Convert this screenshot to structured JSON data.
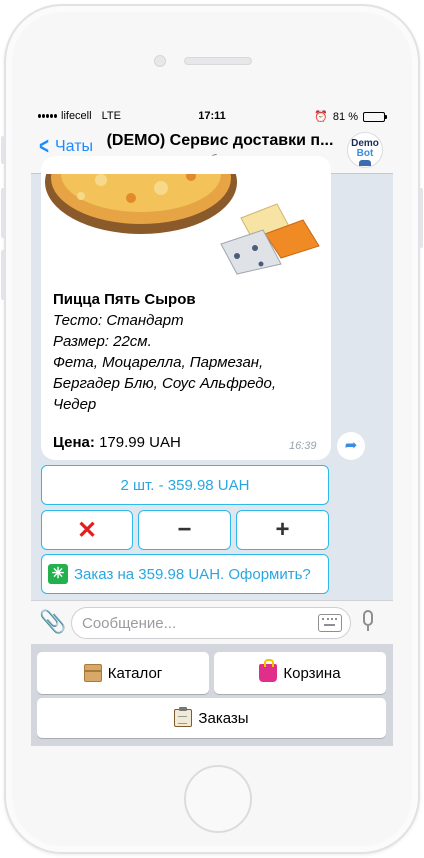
{
  "status_bar": {
    "carrier": "lifecell",
    "network": "LTE",
    "time": "17:11",
    "battery": "81 %",
    "battery_level": 0.81
  },
  "nav": {
    "back_label": "Чаты",
    "title": "(DEMO) Сервис доставки п...",
    "subtitle": "бот",
    "avatar_line1": "Demo",
    "avatar_line2": "Bot"
  },
  "message": {
    "product_name": "Пицца Пять Сыров",
    "dough": "Тесто: Стандарт",
    "size": "Размер: 22см.",
    "ingredients": "Фета, Моцарелла, Пармезан, Бергадер Блю, Соус Альфредо, Чедер",
    "price_label": "Цена:",
    "price_value": "179.99 UAH",
    "time": "16:39"
  },
  "inline_keyboard": {
    "quantity": "2 шт. - 359.98 UAH",
    "remove": "✕",
    "minus": "−",
    "plus": "+",
    "order": "Заказ на 359.98 UAH. Оформить?",
    "order_icon": "✳"
  },
  "input": {
    "placeholder": "Сообщение..."
  },
  "reply_keyboard": {
    "catalog": "Каталог",
    "cart": "Корзина",
    "orders": "Заказы"
  },
  "icons": {
    "back": "chevron-left-icon",
    "share": "share-arrow-icon",
    "attach": "paperclip-icon",
    "keyboard": "keyboard-icon",
    "mic": "microphone-icon",
    "catalog": "box-icon",
    "cart": "shopping-bag-icon",
    "orders": "clipboard-icon"
  },
  "colors": {
    "accent": "#1a8cff",
    "inline_button_border": "#2db9ec",
    "remove": "#e02020",
    "order_icon_bg": "#22b14c",
    "chat_background": "#dfe6ee"
  }
}
